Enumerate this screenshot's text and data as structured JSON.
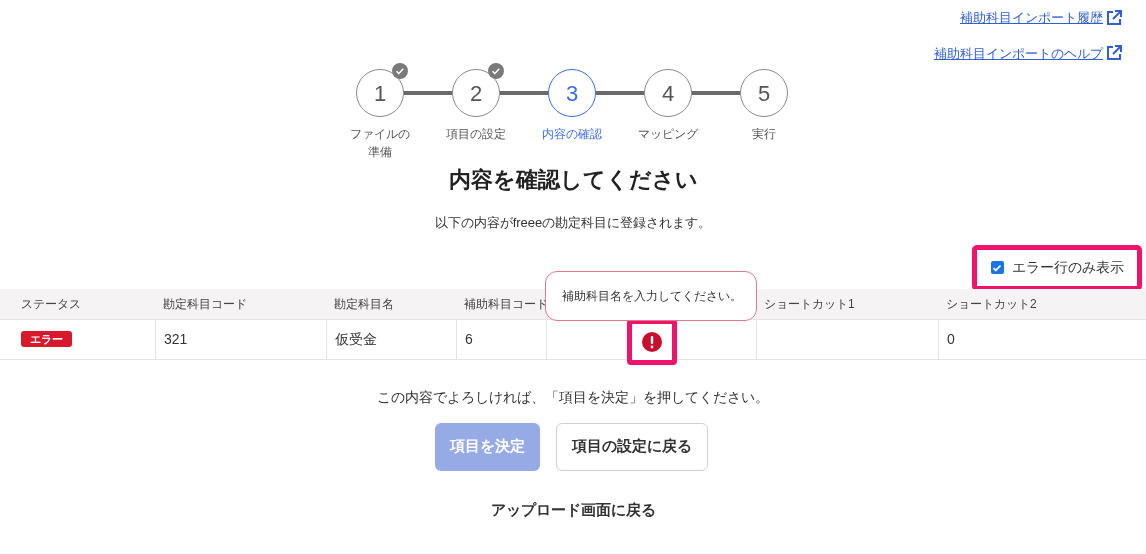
{
  "links": [
    {
      "label": "補助科目インポート履歴"
    },
    {
      "label": "補助科目インポートのヘルプ"
    }
  ],
  "steps": [
    {
      "number": "1",
      "label": "ファイルの準備",
      "done": true,
      "selected": false
    },
    {
      "number": "2",
      "label": "項目の設定",
      "done": true,
      "selected": false
    },
    {
      "number": "3",
      "label": "内容の確認",
      "done": false,
      "selected": true
    },
    {
      "number": "4",
      "label": "マッピング",
      "done": false,
      "selected": false
    },
    {
      "number": "5",
      "label": "実行",
      "done": false,
      "selected": false
    }
  ],
  "title": "内容を確認してください",
  "subtitle": "以下の内容がfreeeの勘定科目に登録されます。",
  "filter": {
    "label": "エラー行のみ表示",
    "checked": true
  },
  "table": {
    "columns": [
      {
        "kind": "text",
        "label": "ステータス"
      },
      {
        "kind": "text",
        "label": "勘定科目コード"
      },
      {
        "kind": "text",
        "label": "勘定科目名"
      },
      {
        "kind": "text",
        "label": "補助科目コード"
      },
      {
        "kind": "covered"
      },
      {
        "kind": "text",
        "label": "ショートカット1"
      },
      {
        "kind": "text",
        "label": "ショートカット2"
      }
    ],
    "rows": [
      {
        "cells": [
          {
            "kind": "badge",
            "text": "エラー"
          },
          {
            "kind": "text",
            "text": "321"
          },
          {
            "kind": "text",
            "text": "仮受金"
          },
          {
            "kind": "text",
            "text": "6"
          },
          {
            "kind": "error"
          },
          {
            "kind": "blank"
          },
          {
            "kind": "text",
            "text": "0"
          }
        ]
      }
    ],
    "tooltip": "補助科目名を入力してください。"
  },
  "instruction": "この内容でよろしければ、「項目を決定」を押してください。",
  "buttons": [
    {
      "label": "項目を決定",
      "disabled": true
    },
    {
      "label": "項目の設定に戻る",
      "disabled": false
    }
  ],
  "back_link": "アップロード画面に戻る"
}
